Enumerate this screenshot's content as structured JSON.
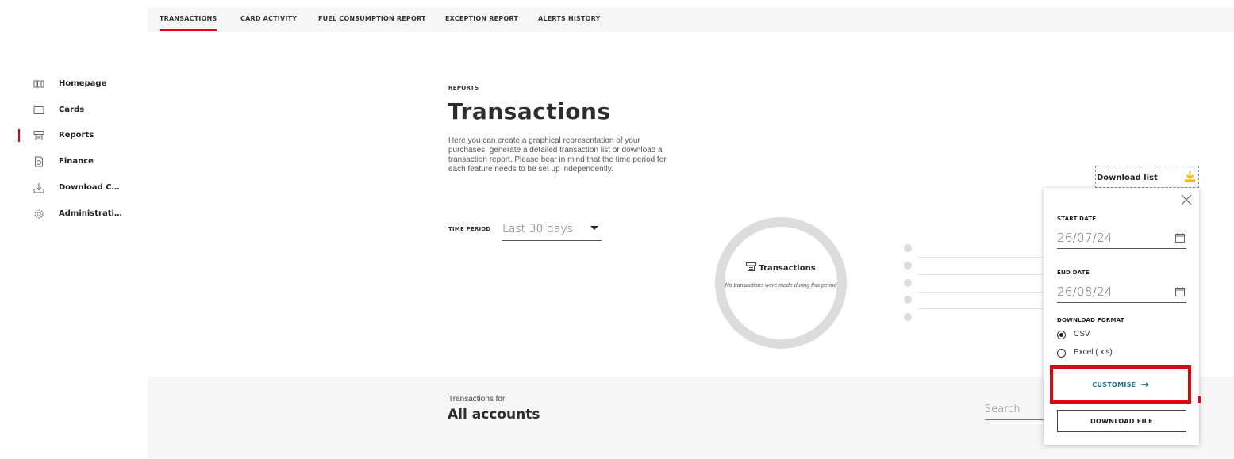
{
  "tabs": [
    {
      "label": "TRANSACTIONS",
      "active": true
    },
    {
      "label": "CARD ACTIVITY",
      "active": false
    },
    {
      "label": "FUEL CONSUMPTION REPORT",
      "active": false
    },
    {
      "label": "EXCEPTION REPORT",
      "active": false
    },
    {
      "label": "ALERTS HISTORY",
      "active": false
    }
  ],
  "sidebar": {
    "items": [
      {
        "label": "Homepage",
        "icon": "homepage-grid-icon",
        "active": false
      },
      {
        "label": "Cards",
        "icon": "card-icon",
        "active": false
      },
      {
        "label": "Reports",
        "icon": "reports-icon",
        "active": true
      },
      {
        "label": "Finance",
        "icon": "finance-icon",
        "active": false
      },
      {
        "label": "Download Centre",
        "icon": "download-icon",
        "active": false
      },
      {
        "label": "Administration",
        "icon": "gear-icon",
        "active": false
      }
    ]
  },
  "header": {
    "eyebrow": "REPORTS",
    "title": "Transactions",
    "description": "Here you can create a graphical representation of your purchases, generate a detailed transaction list or download a transaction report. Please bear in mind that the time period for each feature needs to be set up independently."
  },
  "time_period": {
    "label": "TIME PERIOD",
    "value": "Last 30 days"
  },
  "summary": {
    "title": "Transactions",
    "note": "No transactions were made during this period"
  },
  "list": {
    "label": "Transactions for",
    "title": "All accounts",
    "search_placeholder": "Search"
  },
  "download": {
    "trigger_label": "Download list",
    "start_date_label": "START DATE",
    "start_date": "26/07/24",
    "end_date_label": "END DATE",
    "end_date": "26/08/24",
    "format_label": "DOWNLOAD FORMAT",
    "formats": [
      {
        "label": "CSV",
        "selected": true
      },
      {
        "label": "Excel (.xls)",
        "selected": false
      }
    ],
    "customise_label": "CUSTOMISE",
    "download_file_label": "DOWNLOAD FILE"
  },
  "colors": {
    "accent_red": "#e3000b",
    "download_icon_yellow": "#f2b705",
    "customise_teal": "#1e6f8a",
    "donut_grey": "#dcdcdc"
  }
}
